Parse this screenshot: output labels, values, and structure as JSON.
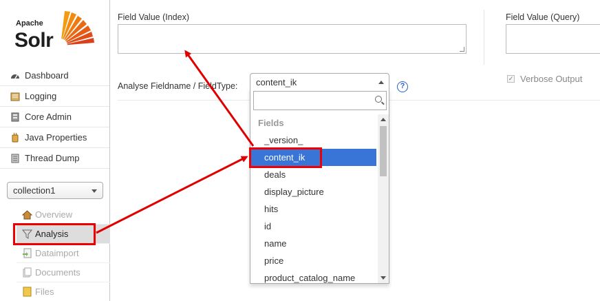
{
  "logo": {
    "apache": "Apache",
    "solr": "Solr"
  },
  "nav": {
    "items": [
      {
        "label": "Dashboard",
        "icon": "dashboard-icon"
      },
      {
        "label": "Logging",
        "icon": "logging-icon"
      },
      {
        "label": "Core Admin",
        "icon": "core-admin-icon"
      },
      {
        "label": "Java Properties",
        "icon": "java-icon"
      },
      {
        "label": "Thread Dump",
        "icon": "thread-dump-icon"
      }
    ]
  },
  "core_selector": {
    "value": "collection1"
  },
  "core_menu": {
    "items": [
      {
        "label": "Overview",
        "icon": "home-icon"
      },
      {
        "label": "Analysis",
        "icon": "filter-icon"
      },
      {
        "label": "Dataimport",
        "icon": "dataimport-icon"
      },
      {
        "label": "Documents",
        "icon": "documents-icon"
      },
      {
        "label": "Files",
        "icon": "files-icon"
      }
    ]
  },
  "analysis": {
    "field_value_index_label": "Field Value (Index)",
    "field_value_query_label": "Field Value (Query)",
    "fieldname_label": "Analyse Fieldname / FieldType:",
    "selected_fieldtype": "content_ik",
    "verbose_label": "Verbose Output",
    "verbose_checked": true,
    "help_glyph": "?"
  },
  "dropdown": {
    "search_value": "",
    "group_label": "Fields",
    "options": [
      "_version_",
      "content_ik",
      "deals",
      "display_picture",
      "hits",
      "id",
      "name",
      "price",
      "product_catalog_name"
    ],
    "highlighted": "content_ik"
  },
  "colors": {
    "highlight": "#3875d7",
    "annotation": "#e00000",
    "help": "#2a62c9"
  }
}
